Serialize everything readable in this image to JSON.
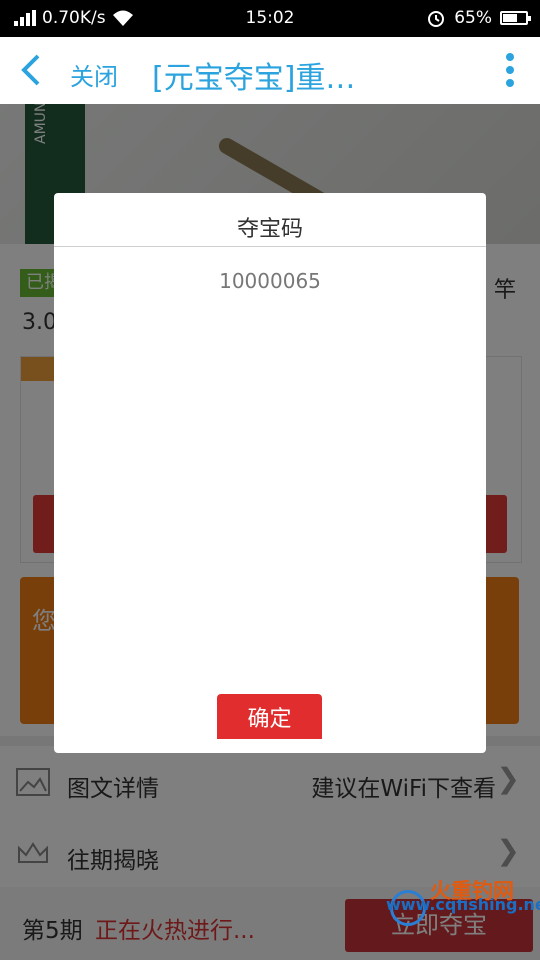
{
  "status_bar": {
    "speed": "0.70K/s",
    "time": "15:02",
    "battery": "65%",
    "battery_level": 0.65
  },
  "nav": {
    "close_label": "关闭",
    "title": "[元宝夺宝]重…"
  },
  "background": {
    "box_text": "AMUNDSON",
    "badge_text": "已揭",
    "line1_text": "3.0",
    "line1_right_text": "竿",
    "orange_text": "您",
    "rows": [
      {
        "label": "图文详情",
        "right": "建议在WiFi下查看"
      },
      {
        "label": "往期揭晓",
        "right": ""
      }
    ],
    "bottom": {
      "period": "第5期",
      "status": "正在火热进行...",
      "buy_label": "立即夺宝"
    },
    "watermark": {
      "brand": "火重钓网",
      "url": "www.cqfishing.net"
    }
  },
  "dialog": {
    "title": "夺宝码",
    "code": "10000065",
    "confirm_label": "确定"
  }
}
